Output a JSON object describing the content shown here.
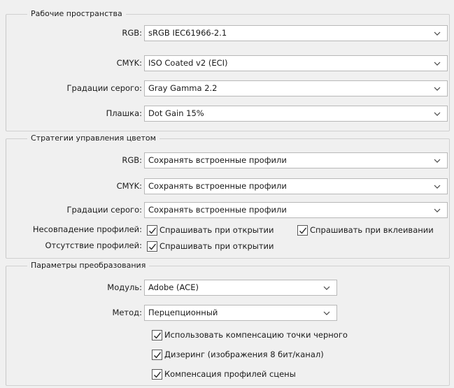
{
  "workspaces": {
    "title": "Рабочие пространства",
    "rows": [
      {
        "label": "RGB:",
        "value": "sRGB IEC61966-2.1"
      },
      {
        "label": "CMYK:",
        "value": "ISO Coated v2 (ECI)"
      },
      {
        "label": "Градации серого:",
        "value": "Gray Gamma 2.2"
      },
      {
        "label": "Плашка:",
        "value": "Dot Gain 15%"
      }
    ]
  },
  "policies": {
    "title": "Стратегии управления цветом",
    "rows": [
      {
        "label": "RGB:",
        "value": "Сохранять встроенные профили"
      },
      {
        "label": "CMYK:",
        "value": "Сохранять встроенные профили"
      },
      {
        "label": "Градации серого:",
        "value": "Сохранять встроенные профили"
      }
    ],
    "mismatch": {
      "label": "Несовпадение профилей:",
      "ask_open": {
        "label": "Спрашивать при открытии",
        "checked": true
      },
      "ask_paste": {
        "label": "Спрашивать при вклеивании",
        "checked": true
      }
    },
    "missing": {
      "label": "Отсутствие профилей:",
      "ask_open": {
        "label": "Спрашивать при открытии",
        "checked": true
      }
    }
  },
  "conversion": {
    "title": "Параметры преобразования",
    "engine": {
      "label": "Модуль:",
      "value": "Adobe (ACE)"
    },
    "intent": {
      "label": "Метод:",
      "value": "Перцепционный"
    },
    "black_point": {
      "label": "Использовать компенсацию точки черного",
      "checked": true
    },
    "dither": {
      "label": "Дизеринг (изображения 8 бит/канал)",
      "checked": true
    },
    "scene_comp": {
      "label": "Компенсация профилей сцены",
      "checked": true
    }
  }
}
